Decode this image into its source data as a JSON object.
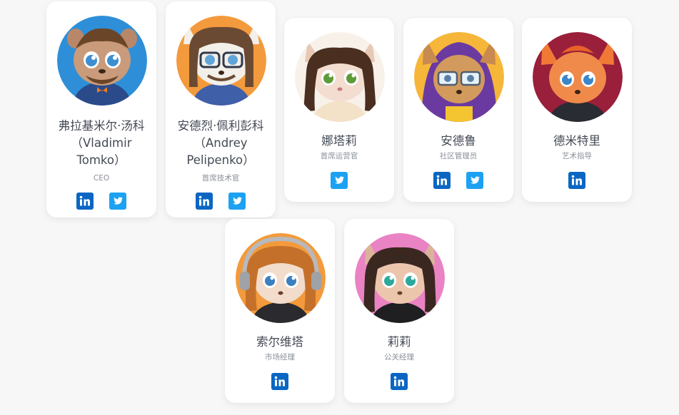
{
  "colors": {
    "linkedin": "#0a66c2",
    "twitter": "#1da1f2"
  },
  "members": [
    {
      "name": "弗拉基米尔·汤科（Vladimir Tomko）",
      "role": "CEO",
      "socials": [
        "linkedin-icon",
        "twitter-icon"
      ]
    },
    {
      "name": "安德烈·佩利彭科（Andrey Pelipenko）",
      "role": "首席技术官",
      "socials": [
        "linkedin-icon",
        "twitter-icon"
      ]
    },
    {
      "name": "娜塔莉",
      "role": "首席运营官",
      "socials": [
        "twitter-icon"
      ]
    },
    {
      "name": "安德鲁",
      "role": "社区管理员",
      "socials": [
        "linkedin-icon",
        "twitter-icon"
      ]
    },
    {
      "name": "德米特里",
      "role": "艺术指导",
      "socials": [
        "linkedin-icon"
      ]
    },
    {
      "name": "索尔维塔",
      "role": "市场经理",
      "socials": [
        "linkedin-icon"
      ]
    },
    {
      "name": "莉莉",
      "role": "公关经理",
      "socials": [
        "linkedin-icon"
      ]
    }
  ]
}
